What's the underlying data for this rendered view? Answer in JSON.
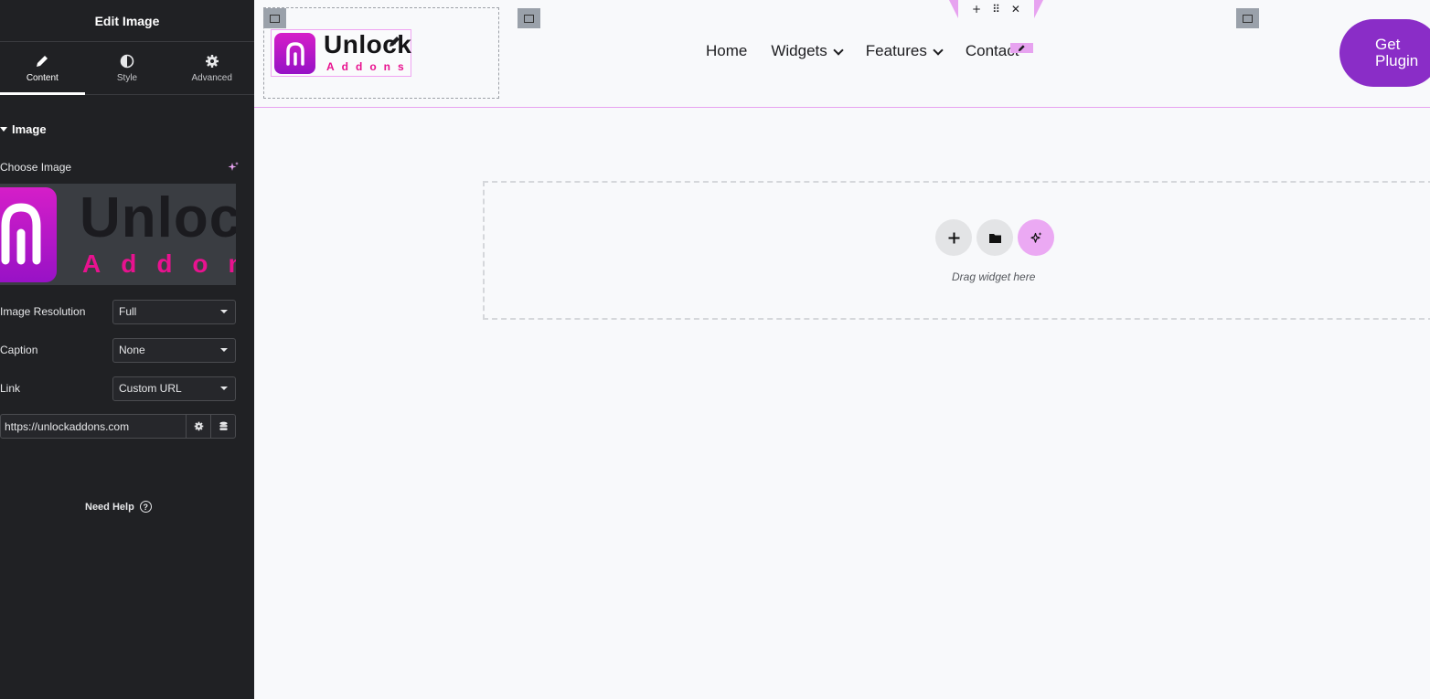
{
  "panel": {
    "title": "Edit Image",
    "tabs": [
      {
        "label": "Content",
        "icon": "pencil-icon",
        "active": true
      },
      {
        "label": "Style",
        "icon": "half-circle-icon",
        "active": false
      },
      {
        "label": "Advanced",
        "icon": "gear-icon",
        "active": false
      }
    ],
    "section_title": "Image",
    "choose_image_label": "Choose Image",
    "preview": {
      "word": "Unloc",
      "sub": "Addon"
    },
    "fields": [
      {
        "label": "Image Resolution",
        "value": "Full"
      },
      {
        "label": "Caption",
        "value": "None"
      },
      {
        "label": "Link",
        "value": "Custom URL"
      }
    ],
    "link_url": "https://unlockaddons.com",
    "need_help": "Need Help",
    "help_glyph": "?"
  },
  "canvas": {
    "logo": {
      "word": "Unlock",
      "sub": "Addons"
    },
    "nav": [
      {
        "label": "Home",
        "has_dropdown": false
      },
      {
        "label": "Widgets",
        "has_dropdown": true
      },
      {
        "label": "Features",
        "has_dropdown": true
      },
      {
        "label": "Contact",
        "has_dropdown": false
      }
    ],
    "toolbar": {
      "add": "+",
      "drag": "⠿",
      "close": "✕"
    },
    "cta": {
      "line1": "Get",
      "line2": "Plugin"
    },
    "drop_hint": "Drag widget here"
  },
  "colors": {
    "panel_bg": "#202124",
    "accent_pink": "#e7a3f0",
    "brand_magenta": "#e8128f",
    "cta_purple": "#8a2dc7",
    "canvas_bg": "#f8f9fb"
  }
}
